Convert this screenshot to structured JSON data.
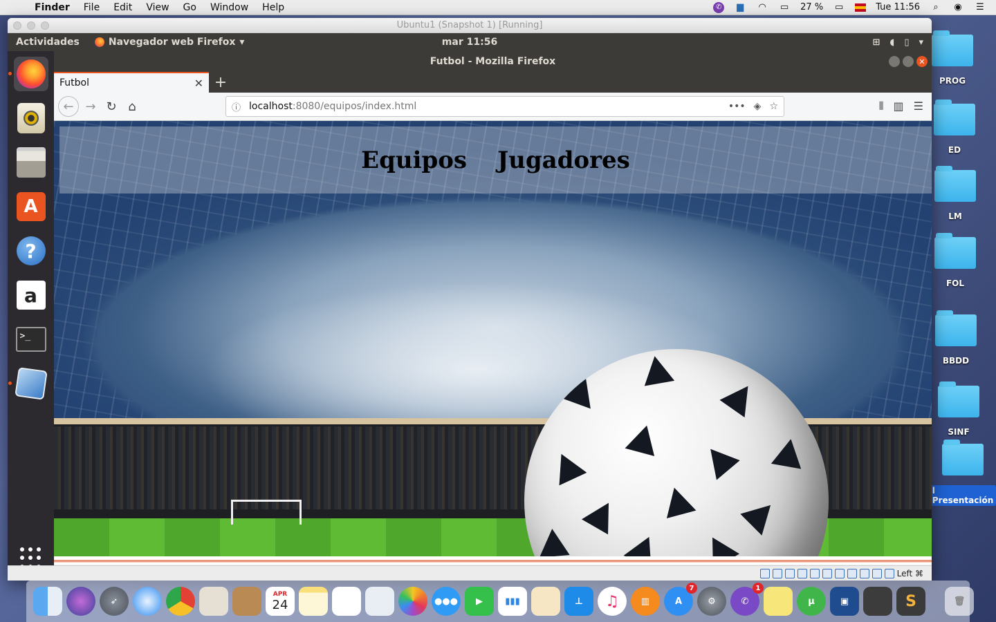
{
  "mac_menubar": {
    "app": "Finder",
    "menus": [
      "File",
      "Edit",
      "View",
      "Go",
      "Window",
      "Help"
    ],
    "battery": "27 %",
    "clock": "Tue 11:56"
  },
  "vbox": {
    "title": "Ubuntu1 (Snapshot 1) [Running]",
    "status_key": "Left ⌘"
  },
  "ubuntu_panel": {
    "activities": "Actividades",
    "app_menu": "Navegador web Firefox",
    "clock": "mar 11:56"
  },
  "firefox": {
    "window_title": "Futbol - Mozilla Firefox",
    "tab_title": "Futbol",
    "url_host": "localhost",
    "url_path": ":8080/equipos/index.html"
  },
  "page": {
    "nav": [
      "Equipos",
      "Jugadores"
    ]
  },
  "desktop_folders": [
    {
      "label": "PROG"
    },
    {
      "label": "ED"
    },
    {
      "label": "LM"
    },
    {
      "label": "FOL"
    },
    {
      "label": "BBDD"
    },
    {
      "label": "SINF"
    },
    {
      "label": "l Presentación"
    }
  ],
  "mac_dock": {
    "calendar_month": "APR",
    "calendar_day": "24",
    "appstore_badge": "7",
    "viber_badge": "1"
  }
}
